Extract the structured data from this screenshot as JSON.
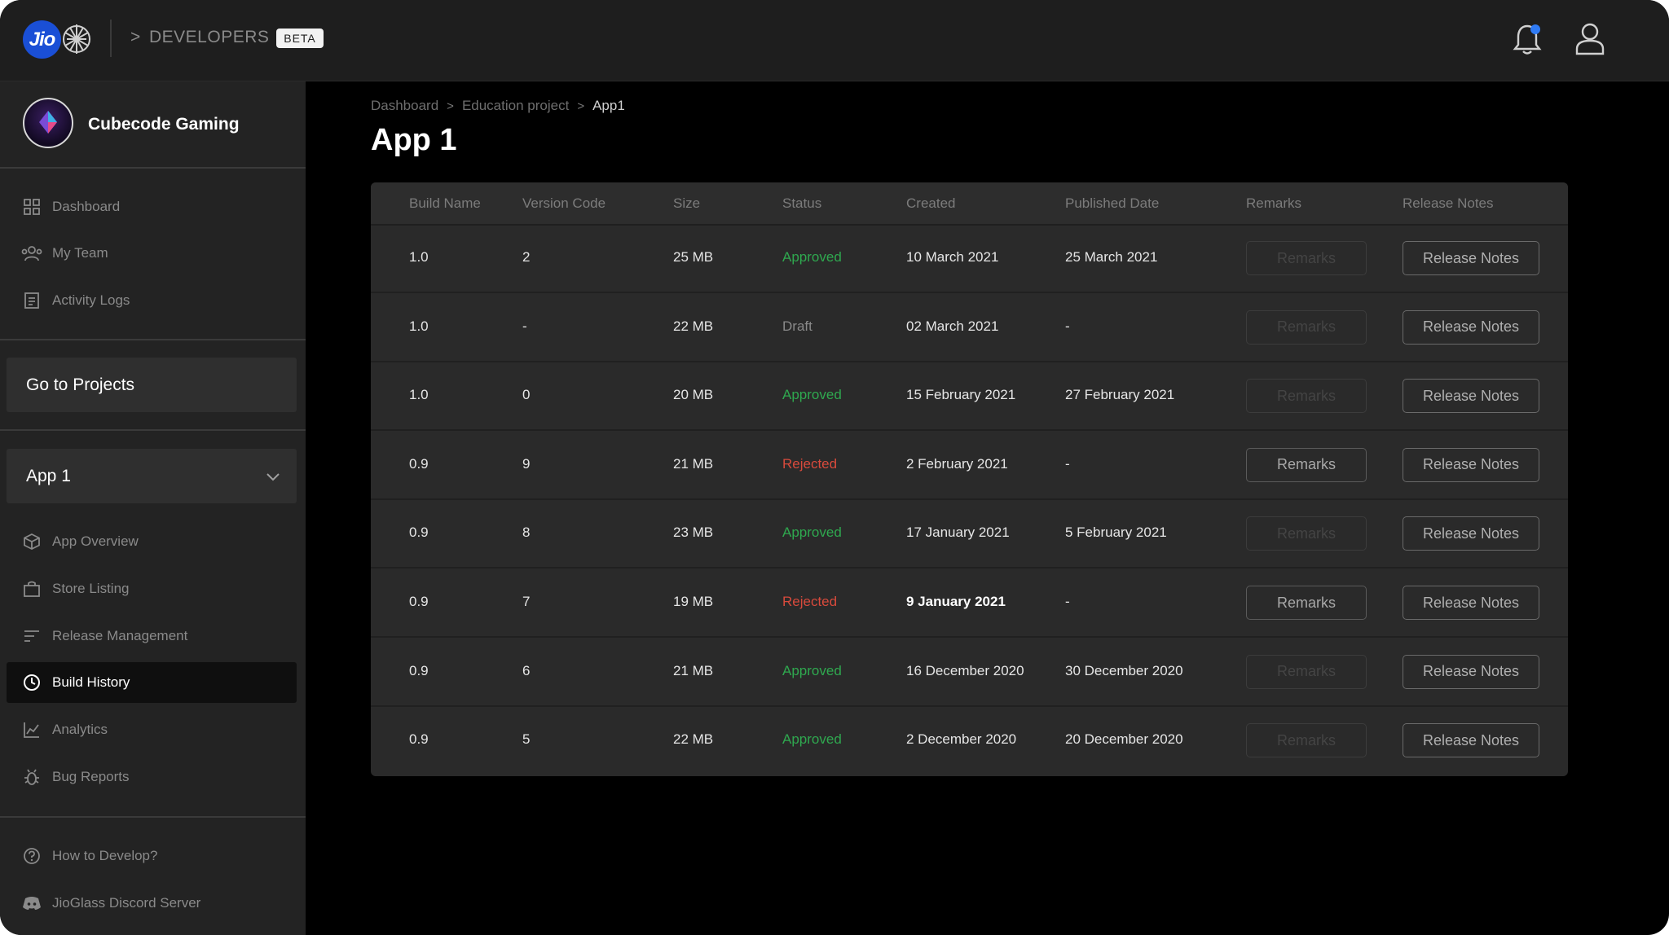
{
  "header": {
    "logo_text": "Jio",
    "prompt": ">",
    "developers_label": "DEVELOPERS",
    "beta_label": "BETA"
  },
  "sidebar": {
    "org_name": "Cubecode Gaming",
    "top_items": [
      {
        "label": "Dashboard",
        "icon": "dashboard-icon"
      },
      {
        "label": "My Team",
        "icon": "team-icon"
      },
      {
        "label": "Activity Logs",
        "icon": "activity-logs-icon"
      }
    ],
    "goto_projects": "Go to Projects",
    "app_select": "App 1",
    "app_items": [
      {
        "label": "App Overview",
        "icon": "cube-icon"
      },
      {
        "label": "Store Listing",
        "icon": "store-icon"
      },
      {
        "label": "Release Management",
        "icon": "release-icon"
      },
      {
        "label": "Build History",
        "icon": "history-icon",
        "active": true
      },
      {
        "label": "Analytics",
        "icon": "analytics-icon"
      },
      {
        "label": "Bug Reports",
        "icon": "bug-icon"
      }
    ],
    "bottom_items": [
      {
        "label": "How to Develop?",
        "icon": "help-icon"
      },
      {
        "label": "JioGlass Discord Server",
        "icon": "discord-icon"
      }
    ]
  },
  "breadcrumb": [
    "Dashboard",
    "Education project",
    "App1"
  ],
  "page_title": "App 1",
  "table": {
    "columns": [
      "Build Name",
      "Version Code",
      "Size",
      "Status",
      "Created",
      "Published Date",
      "Remarks",
      "Release Notes"
    ],
    "remarks_label": "Remarks",
    "notes_label": "Release Notes",
    "rows": [
      {
        "build": "1.0",
        "version": "2",
        "size": "25 MB",
        "status": "Approved",
        "created": "10 March 2021",
        "published": "25 March 2021",
        "remarks_enabled": false
      },
      {
        "build": "1.0",
        "version": "-",
        "size": "22 MB",
        "status": "Draft",
        "created": "02 March 2021",
        "published": "-",
        "remarks_enabled": false
      },
      {
        "build": "1.0",
        "version": "0",
        "size": "20 MB",
        "status": "Approved",
        "created": "15 February 2021",
        "published": "27 February 2021",
        "remarks_enabled": false
      },
      {
        "build": "0.9",
        "version": "9",
        "size": "21 MB",
        "status": "Rejected",
        "created": "2 February 2021",
        "published": "-",
        "remarks_enabled": true
      },
      {
        "build": "0.9",
        "version": "8",
        "size": "23 MB",
        "status": "Approved",
        "created": "17 January 2021",
        "published": "5 February 2021",
        "remarks_enabled": false
      },
      {
        "build": "0.9",
        "version": "7",
        "size": "19 MB",
        "status": "Rejected",
        "created": "9 January 2021",
        "published": "-",
        "remarks_enabled": true
      },
      {
        "build": "0.9",
        "version": "6",
        "size": "21 MB",
        "status": "Approved",
        "created": "16 December 2020",
        "published": "30 December 2020",
        "remarks_enabled": false
      },
      {
        "build": "0.9",
        "version": "5",
        "size": "22 MB",
        "status": "Approved",
        "created": "2 December 2020",
        "published": "20 December 2020",
        "remarks_enabled": false
      }
    ]
  },
  "colors": {
    "approved": "#2fa84f",
    "rejected": "#d84a3c",
    "jio_blue": "#1a4fd6"
  }
}
